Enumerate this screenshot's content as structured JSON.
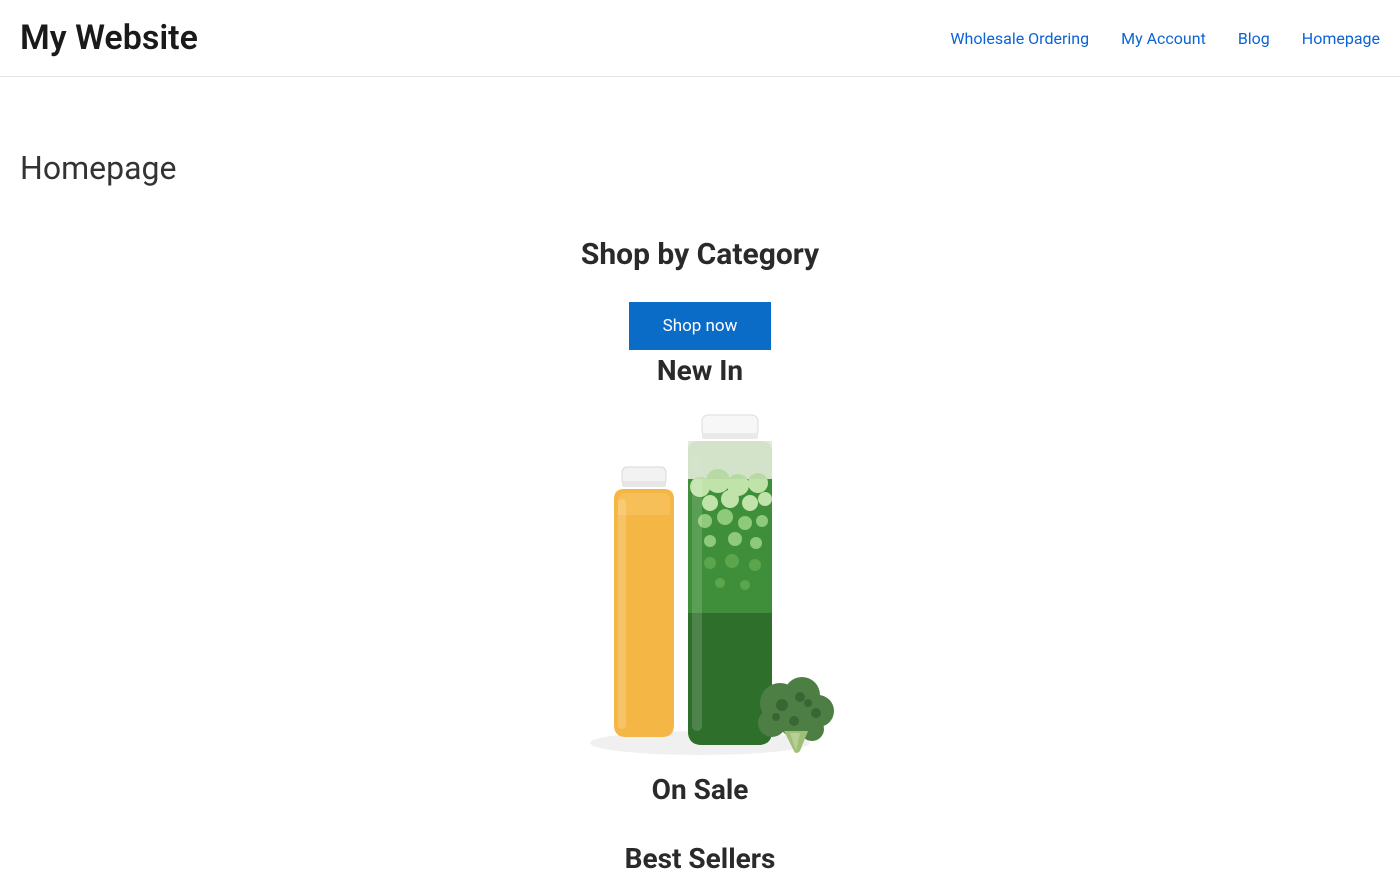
{
  "header": {
    "site_title": "My Website",
    "nav": [
      {
        "label": "Wholesale Ordering"
      },
      {
        "label": "My Account"
      },
      {
        "label": "Blog"
      },
      {
        "label": "Homepage"
      }
    ]
  },
  "page": {
    "heading": "Homepage"
  },
  "sections": {
    "shop_by_category": "Shop by Category",
    "shop_now_button": "Shop now",
    "new_in": "New In",
    "on_sale": "On Sale",
    "best_sellers": "Best Sellers"
  },
  "product_image": {
    "name": "juice-bottles-and-broccoli"
  }
}
